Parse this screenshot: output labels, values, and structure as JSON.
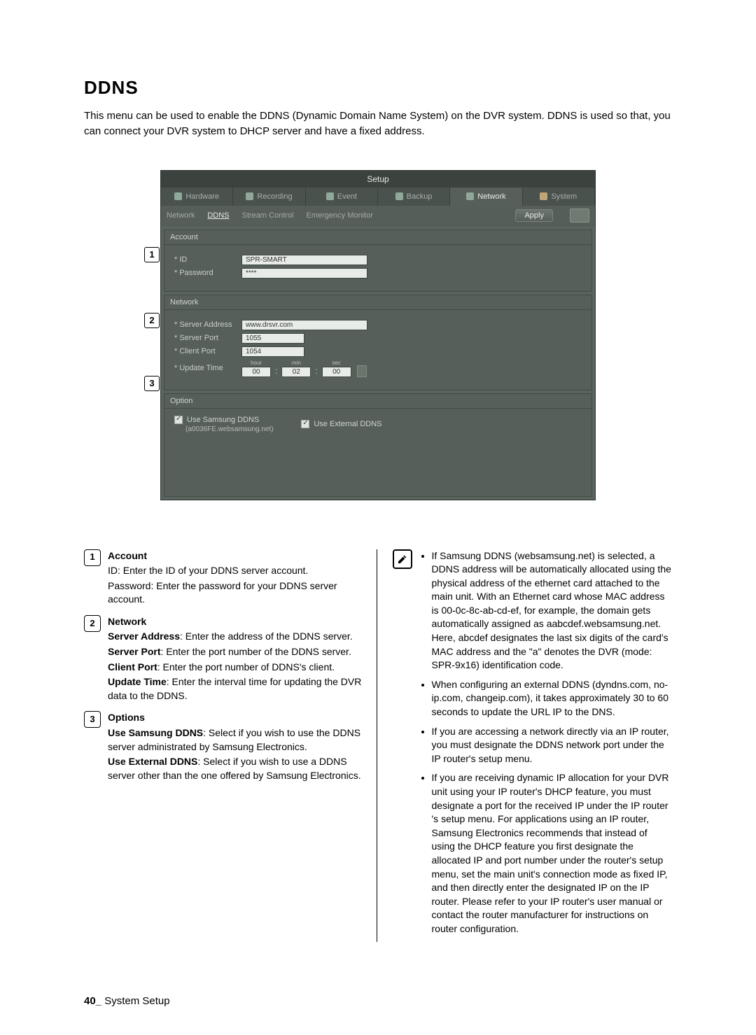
{
  "page": {
    "title": "DDNS",
    "intro": "This menu can be used to enable the DDNS (Dynamic Domain Name System) on the DVR system. DDNS is used so that, you can connect your DVR system to DHCP server and have a fixed address.",
    "footer_page": "40_",
    "footer_section": "System Setup"
  },
  "shot": {
    "windowTitle": "Setup",
    "tabs": {
      "hardware": "Hardware",
      "recording": "Recording",
      "event": "Event",
      "backup": "Backup",
      "network": "Network",
      "system": "System"
    },
    "subTabs": {
      "network": "Network",
      "ddns": "DDNS",
      "stream": "Stream Control",
      "emergency": "Emergency Monitor"
    },
    "applyLabel": "Apply",
    "sections": {
      "account": {
        "header": "Account",
        "idLabel": "* ID",
        "idValue": "SPR-SMART",
        "pwLabel": "* Password",
        "pwValue": "****"
      },
      "network": {
        "header": "Network",
        "serverAddrLabel": "* Server Address",
        "serverAddrValue": "www.drsvr.com",
        "serverPortLabel": "* Server Port",
        "serverPortValue": "1055",
        "clientPortLabel": "* Client Port",
        "clientPortValue": "1054",
        "updateTimeLabel": "* Update Time",
        "hourLabel": "hour",
        "minLabel": "min",
        "secLabel": "sec",
        "hourValue": "00",
        "minValue": "02",
        "secValue": "00"
      },
      "option": {
        "header": "Option",
        "samsungLabel": "Use Samsung DDNS",
        "samsungNote": "(a0036FE.websamsung.net)",
        "externalLabel": "Use External DDNS"
      }
    },
    "callouts": {
      "c1": "1",
      "c2": "2",
      "c3": "3"
    }
  },
  "leftCol": {
    "c1": {
      "num": "1",
      "title": "Account",
      "line1": "ID: Enter the ID of your DDNS server account.",
      "line2": "Password: Enter the password for your DDNS server account."
    },
    "c2": {
      "num": "2",
      "title": "Network",
      "sa_l": "Server Address",
      "sa_t": ": Enter the address of  the DDNS server.",
      "sp_l": "Server Port",
      "sp_t": ": Enter the port number of the DDNS server.",
      "cp_l": "Client Port",
      "cp_t": ": Enter the port number of DDNS's client.",
      "ut_l": "Update Time",
      "ut_t": ": Enter the interval time for updating the DVR data to the DDNS."
    },
    "c3": {
      "num": "3",
      "title": "Options",
      "us_l": "Use Samsung DDNS",
      "us_t": ": Select if you wish to use the DDNS server administrated by Samsung Electronics.",
      "ue_l": "Use External DDNS",
      "ue_t": ": Select if you wish to use a DDNS server other than the one offered by Samsung Electronics."
    }
  },
  "rightCol": {
    "notes": [
      "If Samsung DDNS (websamsung.net) is selected, a DDNS address will be automatically allocated using the physical address of the ethernet card attached to the main unit. With an Ethernet card whose MAC address is 00-0c-8c-ab-cd-ef, for example, the domain gets automatically assigned as aabcdef.websamsung.net. Here, abcdef designates the last six digits of the card's MAC address and the \"a\" denotes the DVR (mode: SPR-9x16) identification code.",
      "When configuring an external DDNS (dyndns.com, no-ip.com, changeip.com), it takes approximately 30 to 60 seconds to update the URL IP to the DNS.",
      "If you are accessing a network directly via an IP router, you must designate the DDNS network port under the IP router's setup menu.",
      "If you are receiving dynamic IP allocation for your DVR unit using your IP router's DHCP feature, you must designate a port for the received IP under the IP router 's setup menu. For applications using an IP router, Samsung Electronics recommends that instead of using the DHCP feature you first designate the allocated IP and port number under the router's setup menu, set the main unit's connection mode as fixed IP, and then directly enter the designated IP on the IP router. Please refer to your IP router's user manual or contact the router manufacturer for instructions on router configuration."
    ]
  }
}
